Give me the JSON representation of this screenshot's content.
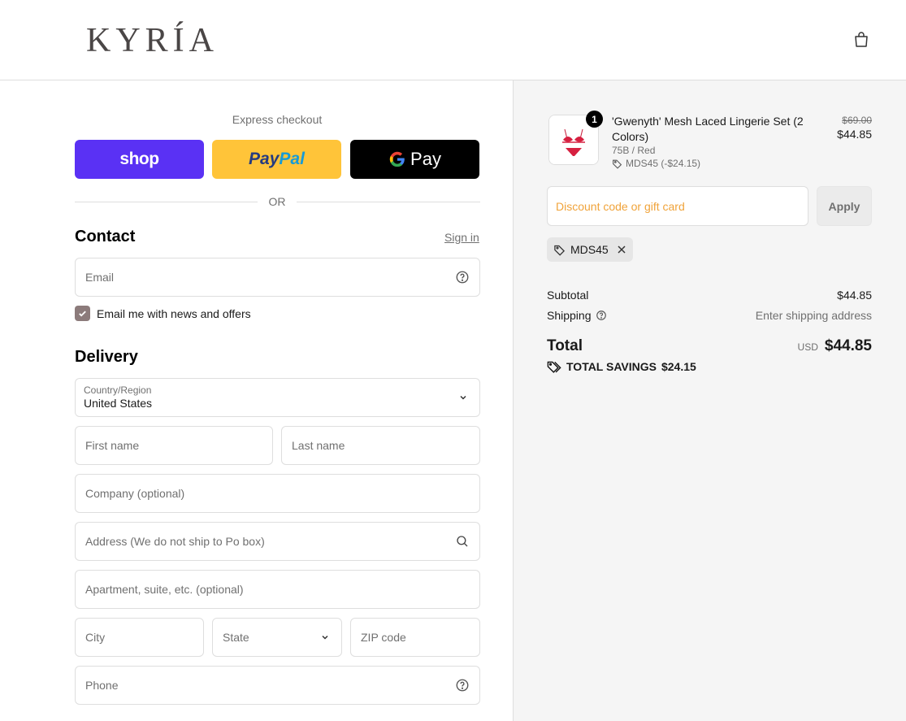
{
  "header": {
    "logo": "KYRÍA",
    "cart_icon": "shopping-bag-icon"
  },
  "express": {
    "label": "Express checkout",
    "shop_label": "shop",
    "paypal_label_1": "Pay",
    "paypal_label_2": "Pal",
    "gpay_g": "G",
    "gpay_label": "Pay",
    "or_text": "OR"
  },
  "contact": {
    "title": "Contact",
    "signin": "Sign in",
    "email_placeholder": "Email",
    "newsletter_label": "Email me with news and offers",
    "newsletter_checked": true
  },
  "delivery": {
    "title": "Delivery",
    "country_label": "Country/Region",
    "country_value": "United States",
    "first_name": "First name",
    "last_name": "Last name",
    "company": "Company (optional)",
    "address": "Address (We do not ship to Po box)",
    "apartment": "Apartment, suite, etc. (optional)",
    "city": "City",
    "state": "State",
    "zip": "ZIP code",
    "phone": "Phone"
  },
  "order": {
    "quantity": "1",
    "product_title": "'Gwenyth' Mesh Laced Lingerie Set (2 Colors)",
    "variant": "75B / Red",
    "discount_line": "MDS45 (-$24.15)",
    "old_price": "$69.00",
    "price": "$44.85",
    "discount_placeholder": "Discount code or gift card",
    "apply_label": "Apply",
    "applied_code": "MDS45",
    "subtotal_label": "Subtotal",
    "subtotal_value": "$44.85",
    "shipping_label": "Shipping",
    "shipping_value": "Enter shipping address",
    "total_label": "Total",
    "currency": "USD",
    "total_value": "$44.85",
    "savings_label": "TOTAL SAVINGS",
    "savings_value": "$24.15"
  },
  "colors": {
    "shop": "#5a31f4",
    "paypal": "#ffc439",
    "gpay": "#000000",
    "accent_placeholder": "#f0a33a",
    "checkbox": "#8c7b7b"
  }
}
